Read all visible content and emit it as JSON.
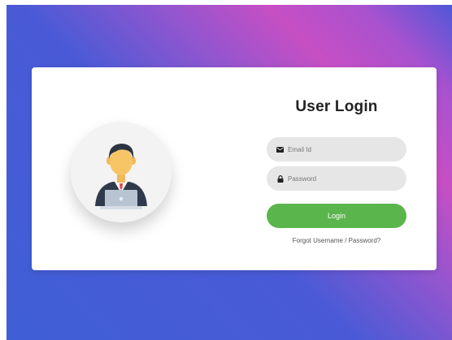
{
  "login": {
    "title": "User Login",
    "email_placeholder": "Email Id",
    "password_placeholder": "Password",
    "login_label": "Login",
    "forgot_label": "Forgot Username / Password?"
  },
  "icons": {
    "email": "envelope-icon",
    "password": "lock-icon",
    "avatar": "user-avatar-illustration"
  },
  "colors": {
    "button": "#5bb54d",
    "field_bg": "#e6e6e6",
    "gradient_start": "#3f5fd6",
    "gradient_mid": "#c74fc4",
    "card_bg": "#ffffff"
  }
}
